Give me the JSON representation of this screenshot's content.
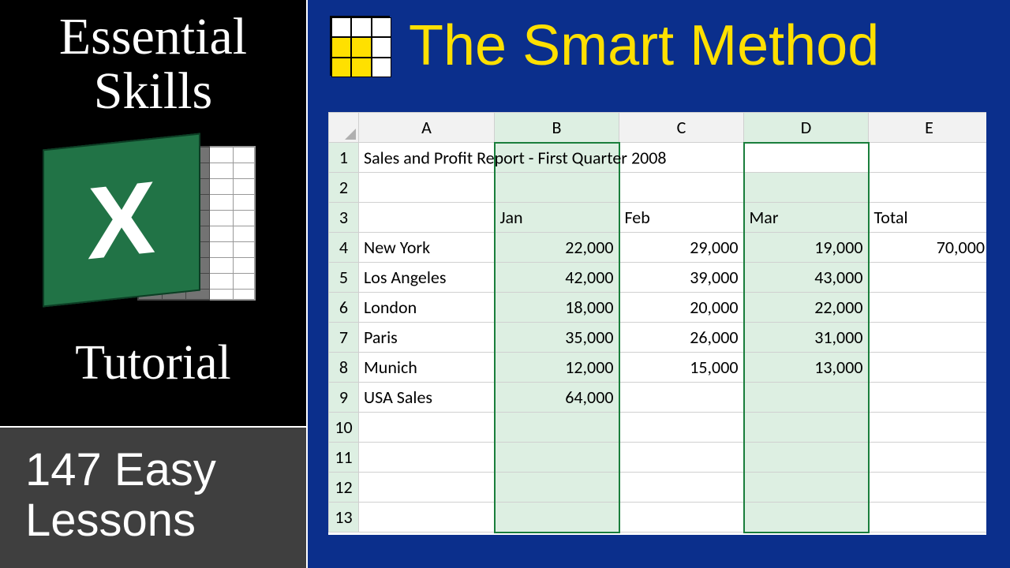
{
  "sidebar": {
    "line1": "Essential",
    "line2": "Skills",
    "tutorial_label": "Tutorial",
    "lesson_line1": "147 Easy",
    "lesson_line2": "Lessons",
    "app_letter": "X"
  },
  "header": {
    "title": "The Smart Method"
  },
  "spreadsheet": {
    "column_letters": [
      "A",
      "B",
      "C",
      "D",
      "E"
    ],
    "selected_columns": [
      "B",
      "D"
    ],
    "visible_rows": 13,
    "title_cell": "Sales and Profit Report - First Quarter 2008",
    "headers": {
      "B": "Jan",
      "C": "Feb",
      "D": "Mar",
      "E": "Total"
    },
    "rows": [
      {
        "label": "New York",
        "jan": "22,000",
        "feb": "29,000",
        "mar": "19,000",
        "total": "70,000"
      },
      {
        "label": "Los Angeles",
        "jan": "42,000",
        "feb": "39,000",
        "mar": "43,000",
        "total": ""
      },
      {
        "label": "London",
        "jan": "18,000",
        "feb": "20,000",
        "mar": "22,000",
        "total": ""
      },
      {
        "label": "Paris",
        "jan": "35,000",
        "feb": "26,000",
        "mar": "31,000",
        "total": ""
      },
      {
        "label": "Munich",
        "jan": "12,000",
        "feb": "15,000",
        "mar": "13,000",
        "total": ""
      },
      {
        "label": "USA Sales",
        "jan": "64,000",
        "feb": "",
        "mar": "",
        "total": ""
      }
    ]
  }
}
